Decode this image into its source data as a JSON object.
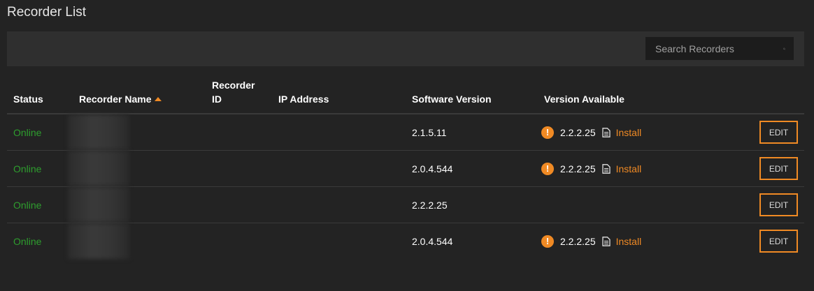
{
  "page": {
    "title": "Recorder List"
  },
  "search": {
    "placeholder": "Search Recorders",
    "icon": "search-icon"
  },
  "table": {
    "columns": {
      "status": "Status",
      "name": "Recorder Name",
      "id_line1": "Recorder",
      "id_line2": "ID",
      "ip": "IP Address",
      "software": "Software Version",
      "available": "Version Available"
    },
    "sort": {
      "column": "name",
      "direction": "asc"
    },
    "rows": [
      {
        "status": "Online",
        "software": "2.1.5.11",
        "available": "2.2.2.25",
        "action": "Install",
        "edit": "EDIT"
      },
      {
        "status": "Online",
        "software": "2.0.4.544",
        "available": "2.2.2.25",
        "action": "Install",
        "edit": "EDIT"
      },
      {
        "status": "Online",
        "software": "2.2.2.25",
        "available": "",
        "action": "",
        "edit": "EDIT"
      },
      {
        "status": "Online",
        "software": "2.0.4.544",
        "available": "2.2.2.25",
        "action": "Install",
        "edit": "EDIT"
      }
    ]
  },
  "colors": {
    "accent": "#f08a24",
    "online": "#2e9e2e",
    "background": "#232323"
  }
}
